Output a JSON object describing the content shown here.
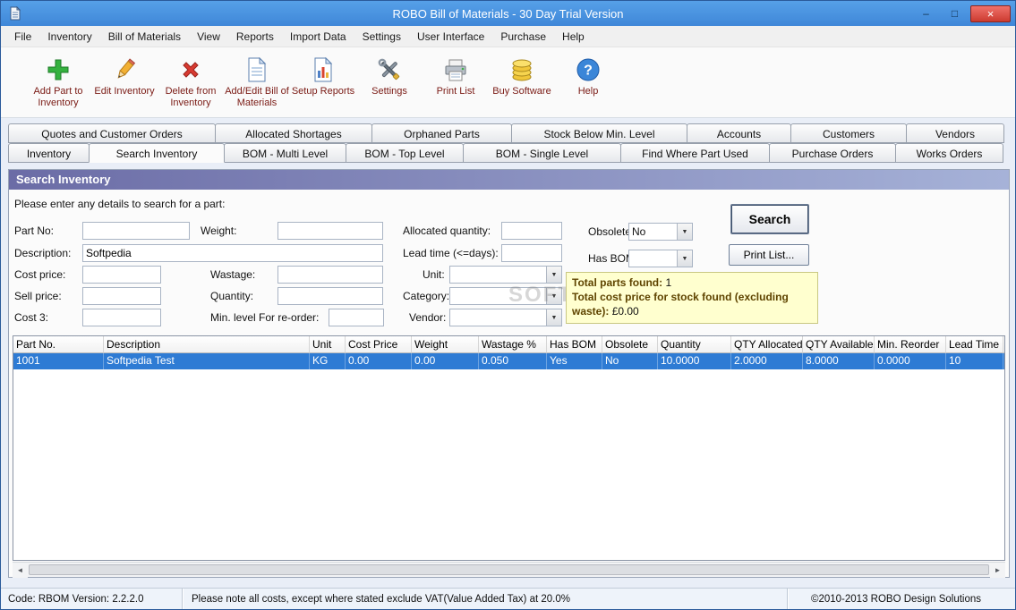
{
  "window": {
    "title": "ROBO Bill of Materials - 30 Day Trial Version",
    "controls": {
      "minimize": "–",
      "maximize": "□",
      "close": "×"
    }
  },
  "menu": {
    "items": [
      "File",
      "Inventory",
      "Bill of Materials",
      "View",
      "Reports",
      "Import Data",
      "Settings",
      "User Interface",
      "Purchase",
      "Help"
    ]
  },
  "toolbar": {
    "buttons": [
      {
        "label": "Add Part to Inventory",
        "icon": "plus-icon"
      },
      {
        "label": "Edit Inventory",
        "icon": "pencil-icon"
      },
      {
        "label": "Delete from Inventory",
        "icon": "delete-x-icon"
      },
      {
        "label": "Add/Edit Bill of Materials",
        "icon": "document-icon"
      },
      {
        "label": "Setup Reports",
        "icon": "report-chart-icon"
      },
      {
        "label": "Settings",
        "icon": "tools-icon"
      },
      {
        "label": "Print List",
        "icon": "printer-icon"
      },
      {
        "label": "Buy Software",
        "icon": "coins-icon"
      },
      {
        "label": "Help",
        "icon": "help-icon"
      }
    ]
  },
  "tabs": {
    "row1": [
      "Quotes and Customer Orders",
      "Allocated Shortages",
      "Orphaned Parts",
      "Stock Below Min. Level",
      "Accounts",
      "Customers",
      "Vendors"
    ],
    "row2": [
      "Inventory",
      "Search Inventory",
      "BOM - Multi Level",
      "BOM - Top Level",
      "BOM - Single Level",
      "Find Where Part Used",
      "Purchase Orders",
      "Works Orders"
    ],
    "active": "Search Inventory"
  },
  "search_panel": {
    "header": "Search Inventory",
    "instruction": "Please enter any details to search for a part:",
    "fields": {
      "part_no": {
        "label": "Part No:",
        "value": ""
      },
      "description": {
        "label": "Description:",
        "value": "Softpedia"
      },
      "cost_price": {
        "label": "Cost price:",
        "value": ""
      },
      "sell_price": {
        "label": "Sell price:",
        "value": ""
      },
      "cost_3": {
        "label": "Cost 3:",
        "value": ""
      },
      "weight": {
        "label": "Weight:",
        "value": ""
      },
      "wastage": {
        "label": "Wastage:",
        "value": ""
      },
      "quantity": {
        "label": "Quantity:",
        "value": ""
      },
      "min_level": {
        "label": "Min. level For re-order:",
        "value": ""
      },
      "allocated_quantity": {
        "label": "Allocated quantity:",
        "value": ""
      },
      "lead_time": {
        "label": "Lead time (<=days):",
        "value": ""
      },
      "unit": {
        "label": "Unit:",
        "value": ""
      },
      "category": {
        "label": "Category:",
        "value": ""
      },
      "vendor": {
        "label": "Vendor:",
        "value": ""
      },
      "obsolete": {
        "label": "Obsolete:",
        "value": "No"
      },
      "has_bom": {
        "label": "Has BOM:",
        "value": ""
      }
    },
    "buttons": {
      "search": "Search",
      "print_list": "Print List..."
    },
    "summary": {
      "line1_label": "Total parts found:",
      "line1_value": "1",
      "line2_label": "Total cost price for stock found (excluding waste):",
      "line2_value": "£0.00"
    }
  },
  "results_table": {
    "columns": [
      "Part No.",
      "Description",
      "Unit",
      "Cost Price",
      "Weight",
      "Wastage %",
      "Has BOM",
      "Obsolete",
      "Quantity",
      "QTY Allocated",
      "QTY Available",
      "Min. Reorder",
      "Lead Time"
    ],
    "rows": [
      [
        "1001",
        "Softpedia Test",
        "KG",
        "0.00",
        "0.00",
        "0.050",
        "Yes",
        "No",
        "10.0000",
        "2.0000",
        "8.0000",
        "0.0000",
        "10"
      ]
    ]
  },
  "scrollbar": {
    "left_arrow": "◄",
    "right_arrow": "►"
  },
  "status_bar": {
    "left": "Code: RBOM Version: 2.2.2.0",
    "center": "Please note all costs, except where stated exclude VAT(Value Added Tax) at 20.0%",
    "right": "©2010-2013 ROBO Design Solutions"
  },
  "watermark": "SOFTPEDIA"
}
